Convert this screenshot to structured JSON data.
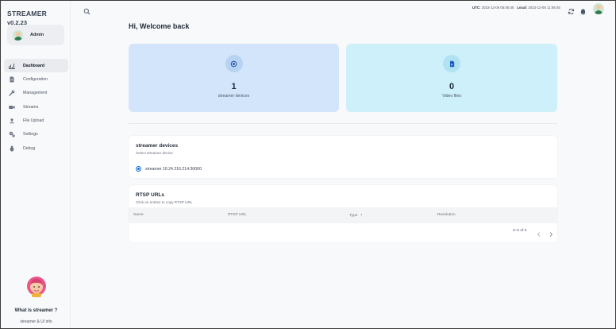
{
  "app": {
    "name": "STREAMER",
    "version": "v0.2.23"
  },
  "account": {
    "name": "Admin"
  },
  "sidebar": {
    "items": [
      {
        "label": "Dashboard",
        "icon": "dashboard-icon",
        "active": true
      },
      {
        "label": "Configuration",
        "icon": "document-icon",
        "active": false
      },
      {
        "label": "Management",
        "icon": "wrench-icon",
        "active": false
      },
      {
        "label": "Streams",
        "icon": "video-icon",
        "active": false
      },
      {
        "label": "File Upload",
        "icon": "upload-icon",
        "active": false
      },
      {
        "label": "Settings",
        "icon": "gears-icon",
        "active": false
      },
      {
        "label": "Debug",
        "icon": "bug-icon",
        "active": false
      }
    ],
    "help": {
      "question": "What is streamer ?",
      "link": "streamer & UI info"
    }
  },
  "topbar": {
    "utc_label": "UTC:",
    "utc_value": "2023-12-06 05:06:45",
    "local_label": "Local:",
    "local_value": "2023-12-06 11:06:45"
  },
  "main": {
    "welcome": "Hi, Welcome back",
    "stats": [
      {
        "value": "1",
        "caption": "streamer devices",
        "icon": "target-icon",
        "color": "#d3e5fa"
      },
      {
        "value": "0",
        "caption": "Video files",
        "icon": "file-icon",
        "color": "#cdf0fa"
      }
    ],
    "devices": {
      "title": "streamer devices",
      "subtitle": "Select streamer device",
      "options": [
        {
          "label": "streamer 10.24.216.214:30000",
          "selected": true
        }
      ]
    },
    "rtsp": {
      "title": "RTSP URLs",
      "subtitle": "Click on entries to copy RTSP URL",
      "columns": [
        "Name",
        "RTSP URL",
        "Type",
        "Resolution"
      ],
      "sort_indicator": "↑",
      "rows": [],
      "pagination": "0–0 of 0"
    }
  },
  "colors": {
    "accent": "#1d6fd6",
    "stat_blue": "#d3e5fa",
    "stat_cyan": "#cdf0fa"
  }
}
